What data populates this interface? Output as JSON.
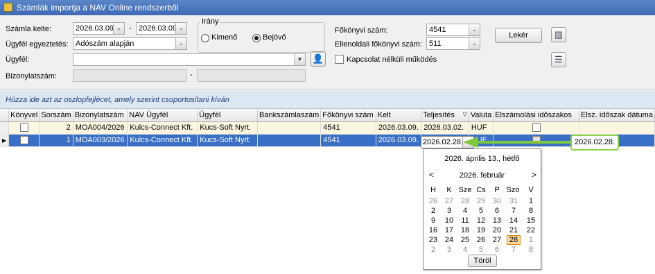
{
  "window": {
    "title": "Számlák importja a NAV Online rendszerből"
  },
  "filter": {
    "invoice_date_label": "Számla kelte:",
    "date_from": "2026.03.09.",
    "date_sep": "-",
    "date_to": "2026.03.09.",
    "customer_match_label": "Ügyfél egyeztetés:",
    "customer_match_value": "Adószám alapján",
    "customer_label": "Ügyfél:",
    "customer_value": "",
    "doc_number_label": "Bizonylatszám:",
    "doc_sep": "-",
    "direction_title": "Irány",
    "direction_out": "Kimenő",
    "direction_in": "Bejövő",
    "direction_selected": "Bejövő",
    "ledger_label": "Főkönyvi szám:",
    "ledger_value": "4541",
    "counter_ledger_label": "Ellenoldali főkönyvi szám:",
    "counter_ledger_value": "511",
    "offline_label": "Kapcsolat nélküli működés",
    "fetch_button": "Lekér"
  },
  "grid": {
    "group_hint": "Húzza ide azt az oszlopfejlécet, amely szerint csoportosítani kíván",
    "columns": [
      "Könyvel",
      "Sorszám",
      "Bizonylatszám",
      "NAV Ügyfél",
      "Ügyfél",
      "Bankszámlaszám",
      "Főkönyvi szám",
      "Kelt",
      "Teljesítés",
      "Valuta",
      "Elszámolási időszakos",
      "Elsz. időszak dátuma"
    ],
    "sort_marker": "▽",
    "rows": [
      {
        "seq": "2",
        "doc": "MOA004/2026",
        "nav_customer": "Kulcs-Connect Kft.",
        "customer": "Kucs-Soft Nyrt.",
        "bank": "",
        "ledger": "4541",
        "date": "2026.03.09.",
        "fulfil": "2026.03.02.",
        "currency": "HUF",
        "period_date": ""
      },
      {
        "seq": "1",
        "doc": "MOA003/2026",
        "nav_customer": "Kulcs-Connect Kft.",
        "customer": "Kucs-Soft Nyrt.",
        "bank": "",
        "ledger": "4541",
        "date": "2026.03.09.",
        "fulfil": "2026.02.28.",
        "currency": "HUF",
        "period_date": "2026.02.28."
      }
    ]
  },
  "calendar": {
    "today": "2026. április 13., hétfő",
    "month": "2026. február",
    "prev": "<",
    "next": ">",
    "weekdays": [
      "H",
      "K",
      "Sze",
      "Cs",
      "P",
      "Szo",
      "V"
    ],
    "weeks": [
      [
        "26",
        "27",
        "28",
        "29",
        "30",
        "31",
        "1"
      ],
      [
        "2",
        "3",
        "4",
        "5",
        "6",
        "7",
        "8"
      ],
      [
        "9",
        "10",
        "11",
        "12",
        "13",
        "14",
        "15"
      ],
      [
        "16",
        "17",
        "18",
        "19",
        "20",
        "21",
        "22"
      ],
      [
        "23",
        "24",
        "25",
        "26",
        "27",
        "28",
        "1"
      ],
      [
        "2",
        "3",
        "4",
        "5",
        "6",
        "7",
        "8"
      ]
    ],
    "clear_button": "Töröl"
  }
}
